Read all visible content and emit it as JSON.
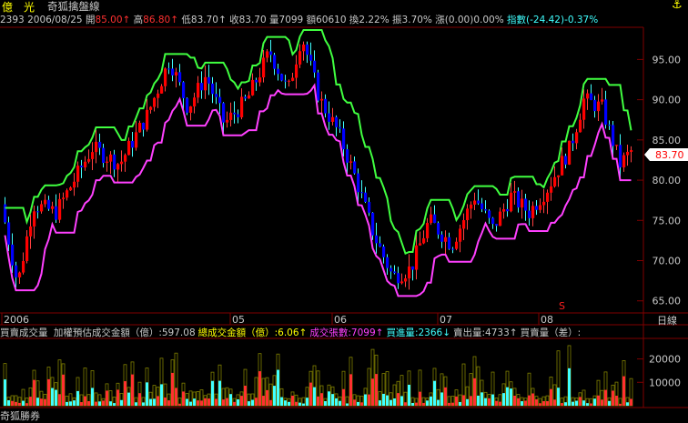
{
  "header": {
    "stock_name": "億　光",
    "indicator_name": "奇狐擒盤線",
    "pin_icon": "pin-icon"
  },
  "info": {
    "code": "2393",
    "date": "2006/08/25",
    "open_label": "開",
    "open_value": "85.00",
    "open_arrow": "↑",
    "high_label": "高",
    "high_value": "86.80",
    "high_arrow": "↑",
    "low_label": "低",
    "low_value": "83.70",
    "low_arrow": "↑",
    "close_label": "收",
    "close_value": "83.70",
    "volume_label": "量",
    "volume_value": "7099",
    "amount_label": "額",
    "amount_value": "60610",
    "turnover_label": "換",
    "turnover_value": "2.22%",
    "amplitude_label": "振",
    "amplitude_value": "3.70%",
    "change_label": "漲",
    "change_value": "(0.00)",
    "change_pct": "0.00%",
    "index_label": "指數",
    "index_value": "(-24.42)-0.37%"
  },
  "price_axis": {
    "ticks": [
      "95.00",
      "90.00",
      "85.00",
      "80.00",
      "75.00",
      "70.00",
      "65.00"
    ],
    "current_price": "83.70"
  },
  "time_axis": {
    "labels": [
      "2006",
      "05",
      "06",
      "07",
      "08"
    ],
    "period": "日線"
  },
  "markers": {
    "s_marker": "S"
  },
  "volume_panel": {
    "title": "買賣成交量",
    "items": [
      {
        "label": "加權預估成交金額（億）",
        "value": ":597.08",
        "arrow": "",
        "color": "#c8c8c8"
      },
      {
        "label": "總成交金額（億）",
        "value": ":6.06",
        "arrow": "↑",
        "color": "#ffff00"
      },
      {
        "label": "成交張數",
        "value": ":7099",
        "arrow": "↑",
        "color": "#ff40ff"
      },
      {
        "label": "買進量",
        "value": ":2366",
        "arrow": "↓",
        "color": "#40ffff"
      },
      {
        "label": "賣出量",
        "value": ":4733",
        "arrow": "↑",
        "color": "#c8c8c8"
      },
      {
        "label": "買賣量（差）",
        "value": ":",
        "arrow": "",
        "color": "#c8c8c8"
      }
    ],
    "axis_ticks": [
      "20000",
      "10000"
    ],
    "footer": "奇狐勝券"
  },
  "colors": {
    "up": "#ff0000",
    "down": "#0000ff",
    "upper_line": "#40ff40",
    "lower_line": "#ff40ff",
    "grid": "#800000",
    "text": "#c8c8c8",
    "volume_buy": "#40ffff",
    "volume_outline": "#808000"
  }
}
